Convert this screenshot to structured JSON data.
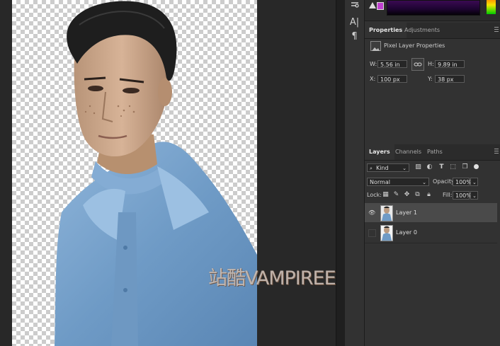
{
  "canvas": {
    "watermark": "站酷VAMPIREE"
  },
  "tools": {
    "icons": [
      "path-select-icon",
      "character-icon",
      "paragraph-icon"
    ],
    "character_glyph": "A|",
    "paragraph_glyph": "¶"
  },
  "properties_panel": {
    "tabs": [
      "Properties",
      "Adjustments"
    ],
    "active_tab": "Properties",
    "section_title": "Pixel Layer Properties",
    "w_label": "W:",
    "w_value": "5.56 in",
    "h_label": "H:",
    "h_value": "9.89 in",
    "x_label": "X:",
    "x_value": "100 px",
    "y_label": "Y:",
    "y_value": "38 px"
  },
  "layers_panel": {
    "tabs": [
      "Layers",
      "Channels",
      "Paths"
    ],
    "active_tab": "Layers",
    "filter_kind": "Kind",
    "blend_mode": "Normal",
    "opacity_label": "Opacity:",
    "opacity_value": "100%",
    "lock_label": "Lock:",
    "fill_label": "Fill:",
    "fill_value": "100%",
    "layers": [
      {
        "name": "Layer 1",
        "visible": true,
        "selected": true
      },
      {
        "name": "Layer 0",
        "visible": false,
        "selected": false
      }
    ]
  },
  "colors": {
    "accent_swatch": "#c040d0",
    "shirt": "#7fa7cf",
    "hair": "#1e1e1e"
  }
}
